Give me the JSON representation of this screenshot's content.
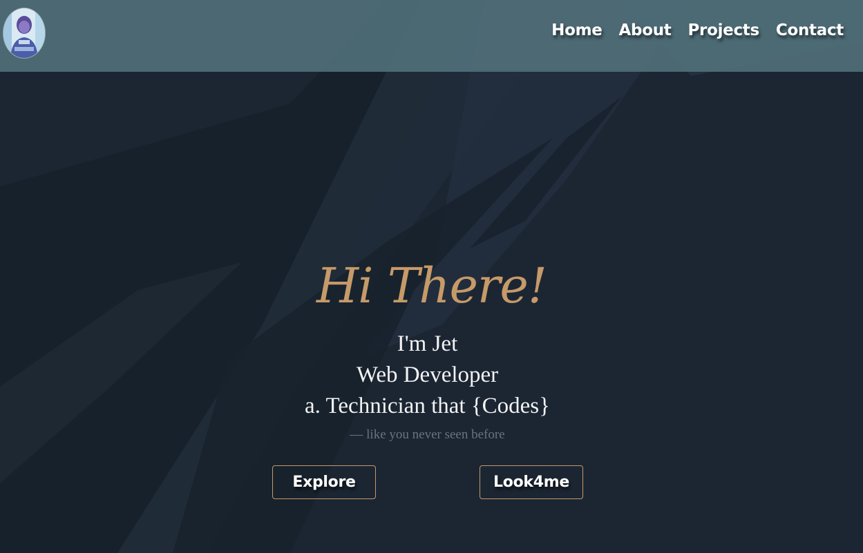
{
  "nav": {
    "avatar_icon": "profile-avatar",
    "links": [
      "Home",
      "About",
      "Projects",
      "Contact"
    ]
  },
  "hero": {
    "title": "Hi There!",
    "line1": "I'm Jet",
    "line2": "Web Developer",
    "line3": "a. Technician that {Codes}",
    "tagline": "— like you never seen before",
    "buttons": {
      "explore": "Explore",
      "look": "Look4me"
    }
  },
  "colors": {
    "accent": "#c69a69",
    "background": "#1c2633",
    "navbar": "#52727c",
    "text": "#f3f3f3",
    "muted": "#6a7480"
  }
}
